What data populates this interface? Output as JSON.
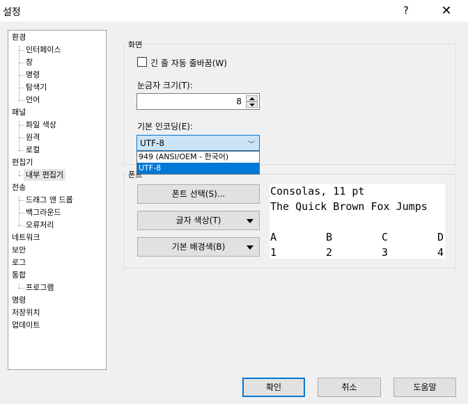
{
  "window": {
    "title": "설정",
    "help_icon": "?",
    "close_icon": "✕"
  },
  "sidebar": {
    "groups": [
      {
        "label": "환경",
        "children": [
          "인터페이스",
          "창",
          "명령",
          "탐색기",
          "언어"
        ]
      },
      {
        "label": "패널",
        "children": [
          "파일 색상",
          "원격",
          "로컬"
        ]
      },
      {
        "label": "편집기",
        "children": [
          "내부 편집기"
        ]
      },
      {
        "label": "전송",
        "children": [
          "드래그 앤 드롭",
          "백그라운드",
          "오류처리"
        ]
      },
      {
        "label": "네트워크",
        "children": []
      },
      {
        "label": "보안",
        "children": []
      },
      {
        "label": "로그",
        "children": []
      },
      {
        "label": "통합",
        "children": [
          "프로그램"
        ]
      },
      {
        "label": "명령",
        "children": []
      },
      {
        "label": "저장위치",
        "children": []
      },
      {
        "label": "업데이트",
        "children": []
      }
    ],
    "selected": "내부 편집기"
  },
  "display_group": {
    "title": "화면",
    "wrap_lines_label": "긴 줄 자동 줄바꿈(W)",
    "wrap_lines_checked": false,
    "tab_size_label": "눈금자 크기(T):",
    "tab_size_value": "8",
    "encoding_label": "기본 인코딩(E):",
    "encoding_value": "UTF-8",
    "encoding_options": [
      "949   (ANSI/OEM - 한국어)",
      "UTF-8"
    ],
    "encoding_selected_index": 1
  },
  "font_group": {
    "title": "폰트",
    "select_font_button": "폰트 선택(S)...",
    "text_color_button": "글자 색상(T)",
    "bg_color_button": "기본 배경색(B)",
    "preview": {
      "line1": "Consolas, 11 pt",
      "line2": "The Quick Brown Fox Jumps",
      "columns": [
        "A",
        "B",
        "C",
        "D"
      ],
      "values": [
        "1",
        "2",
        "3",
        "4"
      ]
    }
  },
  "footer": {
    "ok_button": "확인",
    "cancel_button": "취소",
    "help_button": "도움말"
  },
  "colors": {
    "accent": "#0078d7",
    "dialog_bg": "#f0f0f0",
    "dropdown_selected": "#0078d7",
    "combo_focus": "#cce4f7"
  }
}
